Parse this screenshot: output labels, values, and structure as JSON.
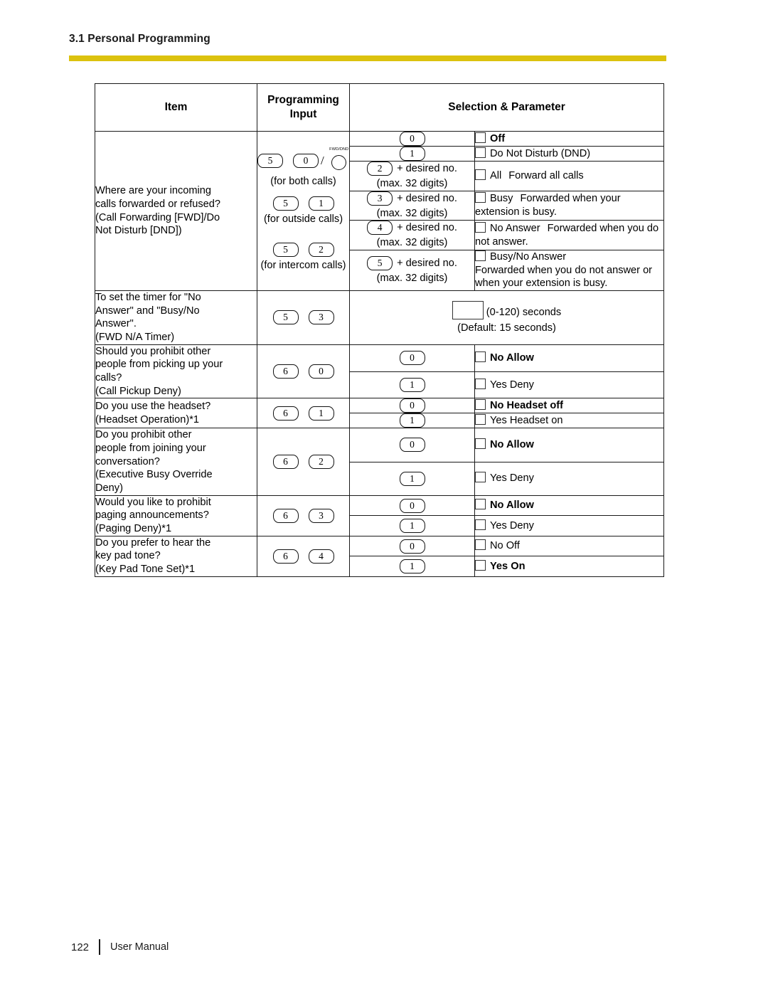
{
  "header": {
    "section_title": "3.1 Personal Programming",
    "rule_color": "#dcc20e"
  },
  "footer": {
    "page_number": "122",
    "label": "User Manual"
  },
  "table": {
    "headers": {
      "item": "Item",
      "input_line1": "Programming",
      "input_line2": "Input",
      "selection": "Selection & Parameter"
    },
    "rows": [
      {
        "item": "Where are your incoming calls forwarded or refused? (Call Forwarding [FWD]/Do Not Disturb [DND])",
        "input": {
          "groups": [
            {
              "keys": [
                "5",
                "0"
              ],
              "has_fwd_dnd": true,
              "fwd_dnd_label": "FWD/DND",
              "note": "(for both calls)"
            },
            {
              "keys": [
                "5",
                "1"
              ],
              "has_fwd_dnd": false,
              "note": "(for outside calls)"
            },
            {
              "keys": [
                "5",
                "2"
              ],
              "has_fwd_dnd": false,
              "note": "(for intercom calls)"
            }
          ]
        },
        "options": [
          {
            "key": "0",
            "suffix": "",
            "suffix2": "",
            "bold_label": "Off",
            "label": "",
            "desc": ""
          },
          {
            "key": "1",
            "suffix": "",
            "suffix2": "",
            "bold_label": "",
            "label": "Do Not Disturb (DND)",
            "desc": ""
          },
          {
            "key": "2",
            "suffix": "+ desired no.",
            "suffix2": "(max. 32 digits)",
            "bold_label": "",
            "label": "All",
            "desc": "Forward all calls"
          },
          {
            "key": "3",
            "suffix": "+ desired no.",
            "suffix2": "(max. 32 digits)",
            "bold_label": "",
            "label": "Busy",
            "desc": "Forwarded when your extension is busy."
          },
          {
            "key": "4",
            "suffix": "+ desired no.",
            "suffix2": "(max. 32 digits)",
            "bold_label": "",
            "label": "No Answer",
            "desc": "Forwarded when you do not answer."
          },
          {
            "key": "5",
            "suffix": "+ desired no.",
            "suffix2": "(max. 32 digits)",
            "bold_label": "",
            "label": "Busy/No Answer",
            "desc": "Forwarded when you do not answer or when your extension is busy."
          }
        ]
      },
      {
        "item": "To set the timer for \"No Answer\" and \"Busy/No Answer\". (FWD N/A Timer)",
        "input": {
          "groups": [
            {
              "keys": [
                "5",
                "3"
              ],
              "has_fwd_dnd": false,
              "note": ""
            }
          ]
        },
        "wide_param": {
          "range": "(0-120) seconds",
          "default": "(Default: 15 seconds)"
        }
      },
      {
        "item": "Should you prohibit other people from picking up your calls? (Call Pickup Deny)",
        "input": {
          "groups": [
            {
              "keys": [
                "6",
                "0"
              ],
              "has_fwd_dnd": false,
              "note": ""
            }
          ]
        },
        "options": [
          {
            "key": "0",
            "suffix": "",
            "suffix2": "",
            "bold_label": "No   Allow",
            "label": "",
            "desc": ""
          },
          {
            "key": "1",
            "suffix": "",
            "suffix2": "",
            "bold_label": "",
            "label": "Yes   Deny",
            "desc": ""
          }
        ]
      },
      {
        "item": "Do you use the headset? (Headset Operation)*1",
        "input": {
          "groups": [
            {
              "keys": [
                "6",
                "1"
              ],
              "has_fwd_dnd": false,
              "note": ""
            }
          ]
        },
        "options": [
          {
            "key": "0",
            "suffix": "",
            "suffix2": "",
            "bold_label": "No   Headset off",
            "label": "",
            "desc": ""
          },
          {
            "key": "1",
            "suffix": "",
            "suffix2": "",
            "bold_label": "",
            "label": "Yes   Headset on",
            "desc": ""
          }
        ]
      },
      {
        "item": "Do you prohibit other people from joining your conversation? (Executive Busy Override Deny)",
        "input": {
          "groups": [
            {
              "keys": [
                "6",
                "2"
              ],
              "has_fwd_dnd": false,
              "note": ""
            }
          ]
        },
        "options": [
          {
            "key": "0",
            "suffix": "",
            "suffix2": "",
            "bold_label": "No   Allow",
            "label": "",
            "desc": ""
          },
          {
            "key": "1",
            "suffix": "",
            "suffix2": "",
            "bold_label": "",
            "label": "Yes   Deny",
            "desc": ""
          }
        ]
      },
      {
        "item": "Would you like to prohibit paging announcements? (Paging Deny)*1",
        "input": {
          "groups": [
            {
              "keys": [
                "6",
                "3"
              ],
              "has_fwd_dnd": false,
              "note": ""
            }
          ]
        },
        "options": [
          {
            "key": "0",
            "suffix": "",
            "suffix2": "",
            "bold_label": "No   Allow",
            "label": "",
            "desc": ""
          },
          {
            "key": "1",
            "suffix": "",
            "suffix2": "",
            "bold_label": "",
            "label": "Yes   Deny",
            "desc": ""
          }
        ]
      },
      {
        "item": "Do you prefer to hear the key pad tone? (Key Pad Tone Set)*1",
        "input": {
          "groups": [
            {
              "keys": [
                "6",
                "4"
              ],
              "has_fwd_dnd": false,
              "note": ""
            }
          ]
        },
        "options": [
          {
            "key": "0",
            "suffix": "",
            "suffix2": "",
            "bold_label": "",
            "label": "No   Off",
            "desc": ""
          },
          {
            "key": "1",
            "suffix": "",
            "suffix2": "",
            "bold_label": "Yes   On",
            "label": "",
            "desc": ""
          }
        ]
      }
    ],
    "item_lines": {
      "r0": [
        "Where are your incoming",
        "calls forwarded or refused?",
        "(Call Forwarding [FWD]/Do",
        "Not Disturb [DND])"
      ],
      "r1": [
        "To set the timer for \"No",
        "Answer\" and \"Busy/No",
        "Answer\".",
        "(FWD N/A Timer)"
      ],
      "r2": [
        "Should you prohibit other",
        "people from picking up your",
        "calls?",
        "(Call Pickup Deny)"
      ],
      "r3": [
        "Do you use the headset?",
        "(Headset Operation)*1"
      ],
      "r4": [
        "Do you prohibit other",
        "people from joining your",
        "conversation?",
        "(Executive Busy Override",
        "Deny)"
      ],
      "r5": [
        "Would you like to prohibit",
        "paging announcements?",
        "(Paging Deny)*1"
      ],
      "r6": [
        "Do you prefer to hear the",
        "key pad tone?",
        "(Key Pad Tone Set)*1"
      ]
    }
  }
}
